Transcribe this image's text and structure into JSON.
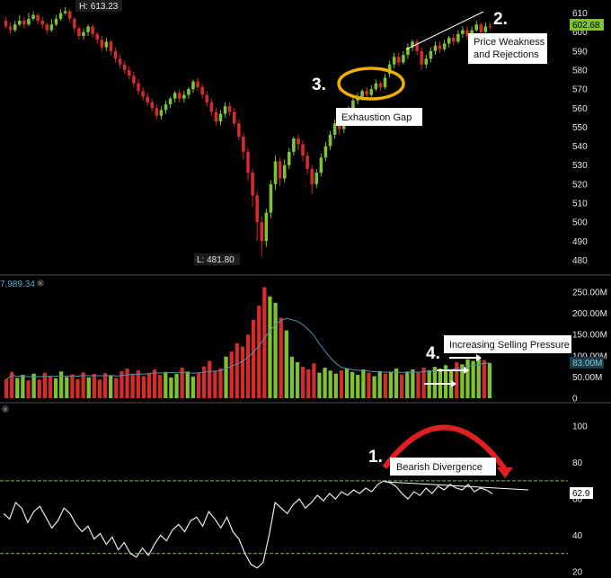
{
  "chart_data": [
    {
      "type": "candlestick",
      "panel": "price",
      "ylim": [
        475,
        615
      ],
      "y_ticks": [
        610,
        600,
        590,
        580,
        570,
        560,
        550,
        540,
        530,
        520,
        510,
        500,
        490,
        480
      ],
      "high_label": "H: 613.23",
      "low_label": "L: 481.80",
      "last_price": "602.68",
      "last_price_color": "#7ec234",
      "candles": [
        [
          606,
          603,
          608,
          602
        ],
        [
          603,
          601,
          605,
          599
        ],
        [
          601,
          604,
          606,
          600
        ],
        [
          604,
          606,
          609,
          603
        ],
        [
          606,
          604,
          608,
          602
        ],
        [
          604,
          607,
          610,
          603
        ],
        [
          607,
          609,
          611,
          606
        ],
        [
          609,
          606,
          610,
          604
        ],
        [
          606,
          604,
          608,
          602
        ],
        [
          604,
          601,
          605,
          599
        ],
        [
          601,
          604,
          607,
          600
        ],
        [
          604,
          607,
          609,
          603
        ],
        [
          607,
          610,
          612,
          606
        ],
        [
          610,
          611,
          613.23,
          609
        ],
        [
          611,
          607,
          612,
          605
        ],
        [
          607,
          602,
          608,
          600
        ],
        [
          602,
          598,
          603,
          596
        ],
        [
          598,
          600,
          602,
          596
        ],
        [
          600,
          603,
          604,
          598
        ],
        [
          603,
          599,
          604,
          597
        ],
        [
          599,
          596,
          600,
          594
        ],
        [
          596,
          592,
          598,
          590
        ],
        [
          592,
          595,
          597,
          590
        ],
        [
          595,
          590,
          596,
          588
        ],
        [
          590,
          586,
          592,
          584
        ],
        [
          586,
          583,
          588,
          581
        ],
        [
          583,
          580,
          585,
          578
        ],
        [
          580,
          577,
          582,
          575
        ],
        [
          577,
          573,
          579,
          571
        ],
        [
          573,
          569,
          575,
          567
        ],
        [
          569,
          566,
          571,
          564
        ],
        [
          566,
          563,
          568,
          561
        ],
        [
          563,
          560,
          565,
          558
        ],
        [
          560,
          556,
          562,
          554
        ],
        [
          556,
          559,
          561,
          554
        ],
        [
          559,
          562,
          564,
          557
        ],
        [
          562,
          565,
          566,
          560
        ],
        [
          565,
          568,
          569,
          563
        ],
        [
          568,
          565,
          570,
          563
        ],
        [
          565,
          567,
          569,
          563
        ],
        [
          567,
          570,
          571,
          565
        ],
        [
          570,
          574,
          575,
          568
        ],
        [
          574,
          571,
          576,
          569
        ],
        [
          571,
          567,
          573,
          565
        ],
        [
          567,
          563,
          569,
          561
        ],
        [
          563,
          558,
          565,
          556
        ],
        [
          558,
          553,
          560,
          551
        ],
        [
          553,
          557,
          559,
          551
        ],
        [
          557,
          561,
          563,
          555
        ],
        [
          561,
          558,
          563,
          556
        ],
        [
          558,
          552,
          560,
          550
        ],
        [
          552,
          545,
          554,
          543
        ],
        [
          545,
          537,
          547,
          533
        ],
        [
          537,
          526,
          539,
          522
        ],
        [
          526,
          514,
          528,
          508
        ],
        [
          514,
          500,
          516,
          490
        ],
        [
          500,
          490,
          503,
          481.8
        ],
        [
          490,
          505,
          507,
          487
        ],
        [
          505,
          520,
          522,
          502
        ],
        [
          520,
          532,
          535,
          517
        ],
        [
          532,
          523,
          534,
          519
        ],
        [
          523,
          530,
          533,
          521
        ],
        [
          530,
          537,
          539,
          528
        ],
        [
          537,
          544,
          545,
          535
        ],
        [
          544,
          541,
          546,
          538
        ],
        [
          541,
          535,
          543,
          532
        ],
        [
          535,
          528,
          537,
          525
        ],
        [
          528,
          520,
          530,
          515
        ],
        [
          520,
          526,
          528,
          518
        ],
        [
          526,
          534,
          536,
          524
        ],
        [
          534,
          540,
          542,
          532
        ],
        [
          540,
          546,
          548,
          538
        ],
        [
          546,
          552,
          554,
          544
        ],
        [
          552,
          549,
          554,
          546
        ],
        [
          549,
          555,
          557,
          547
        ],
        [
          555,
          560,
          561,
          553
        ],
        [
          560,
          564,
          566,
          558
        ],
        [
          564,
          566,
          568,
          562
        ],
        [
          566,
          569,
          570,
          564
        ],
        [
          569,
          567,
          571,
          565
        ],
        [
          567,
          570,
          572,
          566
        ],
        [
          570,
          573,
          575,
          569
        ],
        [
          573,
          571,
          574,
          569
        ],
        [
          571,
          576,
          578,
          570
        ],
        [
          578,
          583,
          585,
          576
        ],
        [
          583,
          587,
          589,
          581
        ],
        [
          587,
          584,
          589,
          582
        ],
        [
          584,
          588,
          590,
          583
        ],
        [
          588,
          592,
          594,
          586
        ],
        [
          592,
          595,
          596,
          590
        ],
        [
          595,
          590,
          596,
          588
        ],
        [
          590,
          583,
          592,
          580
        ],
        [
          583,
          586,
          588,
          581
        ],
        [
          586,
          590,
          592,
          584
        ],
        [
          590,
          593,
          595,
          588
        ],
        [
          593,
          591,
          595,
          589
        ],
        [
          591,
          594,
          596,
          590
        ],
        [
          594,
          597,
          598,
          592
        ],
        [
          597,
          595,
          599,
          593
        ],
        [
          595,
          599,
          601,
          594
        ],
        [
          599,
          601,
          603,
          597
        ],
        [
          601,
          598,
          603,
          596
        ],
        [
          598,
          601,
          603,
          596
        ],
        [
          601,
          604,
          606,
          600
        ],
        [
          604,
          600,
          605,
          598
        ],
        [
          600,
          603,
          605,
          599
        ],
        [
          603,
          602.68,
          605,
          601
        ]
      ]
    },
    {
      "type": "bar",
      "panel": "volume",
      "ylim": [
        0,
        265
      ],
      "y_ticks": [
        "250.00M",
        "200.00M",
        "150.00M",
        "100.00M",
        "50.00M",
        "0"
      ],
      "header_value": "7,989.34",
      "last_volume": "83.00M",
      "last_volume_color": "#5aa8c8",
      "values": [
        45,
        62,
        48,
        55,
        42,
        58,
        44,
        60,
        52,
        47,
        63,
        50,
        56,
        45,
        61,
        49,
        57,
        44,
        59,
        53,
        48,
        64,
        70,
        58,
        66,
        52,
        60,
        68,
        55,
        62,
        49,
        57,
        72,
        63,
        51,
        60,
        75,
        88,
        64,
        70,
        98,
        110,
        130,
        122,
        150,
        185,
        218,
        262,
        240,
        225,
        190,
        160,
        98,
        85,
        74,
        68,
        82,
        60,
        72,
        65,
        58,
        66,
        70,
        62,
        55,
        68,
        60,
        52,
        64,
        58,
        62,
        70,
        56,
        63,
        68,
        60,
        72,
        66,
        74,
        70,
        78,
        68,
        85,
        80,
        92,
        88,
        95,
        90,
        83
      ]
    },
    {
      "type": "line",
      "panel": "rsi",
      "ylim": [
        18,
        110
      ],
      "y_ticks": [
        100,
        80,
        60,
        40,
        20
      ],
      "levels": [
        70,
        30
      ],
      "level_color": "#8ac230",
      "last_value": "62.9",
      "values": [
        52,
        49,
        58,
        55,
        47,
        53,
        56,
        50,
        44,
        48,
        55,
        52,
        46,
        42,
        45,
        38,
        41,
        35,
        39,
        32,
        36,
        30,
        28,
        33,
        29,
        35,
        40,
        37,
        43,
        46,
        42,
        48,
        50,
        45,
        53,
        49,
        44,
        50,
        42,
        38,
        30,
        24,
        22,
        25,
        40,
        58,
        55,
        52,
        57,
        60,
        55,
        58,
        62,
        59,
        63,
        60,
        64,
        62,
        65,
        63,
        66,
        64,
        68,
        70,
        69,
        67,
        63,
        60,
        64,
        62,
        66,
        63,
        67,
        65,
        68,
        66,
        65,
        68,
        64,
        66,
        65,
        62.9
      ]
    }
  ],
  "annotations": {
    "divergence": {
      "number": "1.",
      "label": "Bearish Divergence"
    },
    "weakness": {
      "number": "2.",
      "label_line1": "Price Weakness",
      "label_line2": "and Rejections"
    },
    "gap": {
      "number": "3.",
      "label": "Exhaustion Gap"
    },
    "selling": {
      "number": "4.",
      "label": "Increasing Selling Pressure"
    }
  },
  "colors": {
    "up": "#7ec234",
    "down": "#d42b2b",
    "ellipse": "#f0b000",
    "arc": "#e02020",
    "rsi_line": "#e8e8e8",
    "divider": "#333333"
  }
}
